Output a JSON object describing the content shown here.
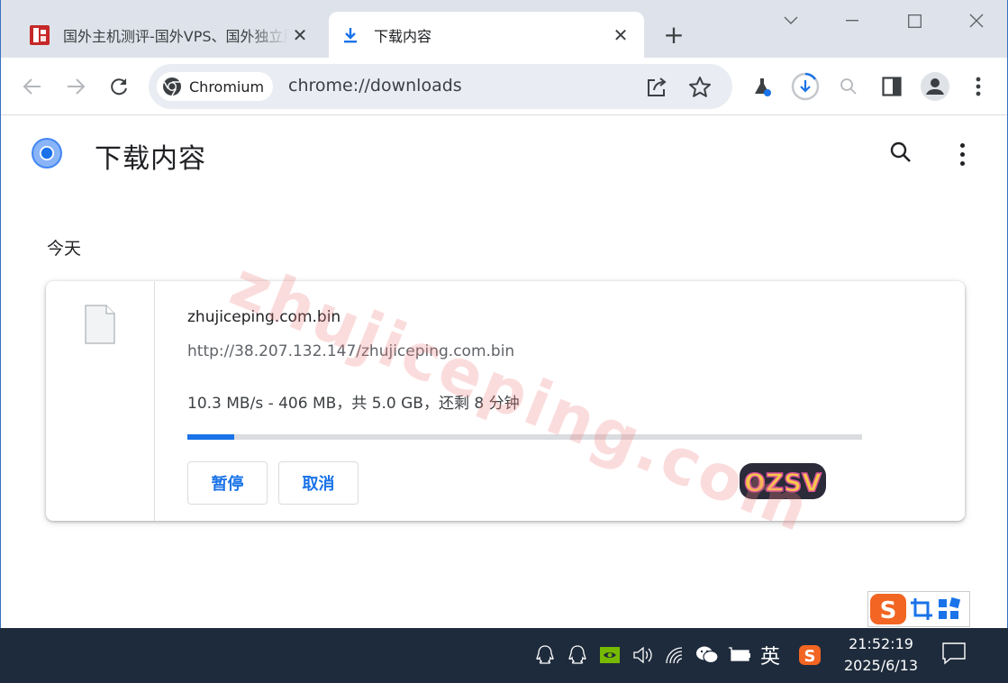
{
  "tabs": [
    {
      "title": "国外主机测评-国外VPS、国外独立服务器",
      "close": "✕"
    },
    {
      "title": "下载内容",
      "close": "✕"
    }
  ],
  "new_tab": "+",
  "omnibox": {
    "chip_label": "Chromium",
    "url": "chrome://downloads"
  },
  "page": {
    "title": "下载内容",
    "date_header": "今天"
  },
  "download": {
    "filename": "zhujiceping.com.bin",
    "url": "http://38.207.132.147/zhujiceping.com.bin",
    "status": "10.3 MB/s - 406 MB，共 5.0 GB，还剩 8 分钟",
    "progress": 0.07,
    "pause_label": "暂停",
    "cancel_label": "取消"
  },
  "watermark": "zhujiceping.com",
  "sticker_text": "OZSV",
  "taskbar": {
    "ime_label": "英",
    "time": "21:52:19",
    "date": "2025/6/13"
  },
  "colors": {
    "accent": "#1a73e8",
    "tabstrip": "#dee3eb",
    "taskbar": "#1e2b3c"
  }
}
